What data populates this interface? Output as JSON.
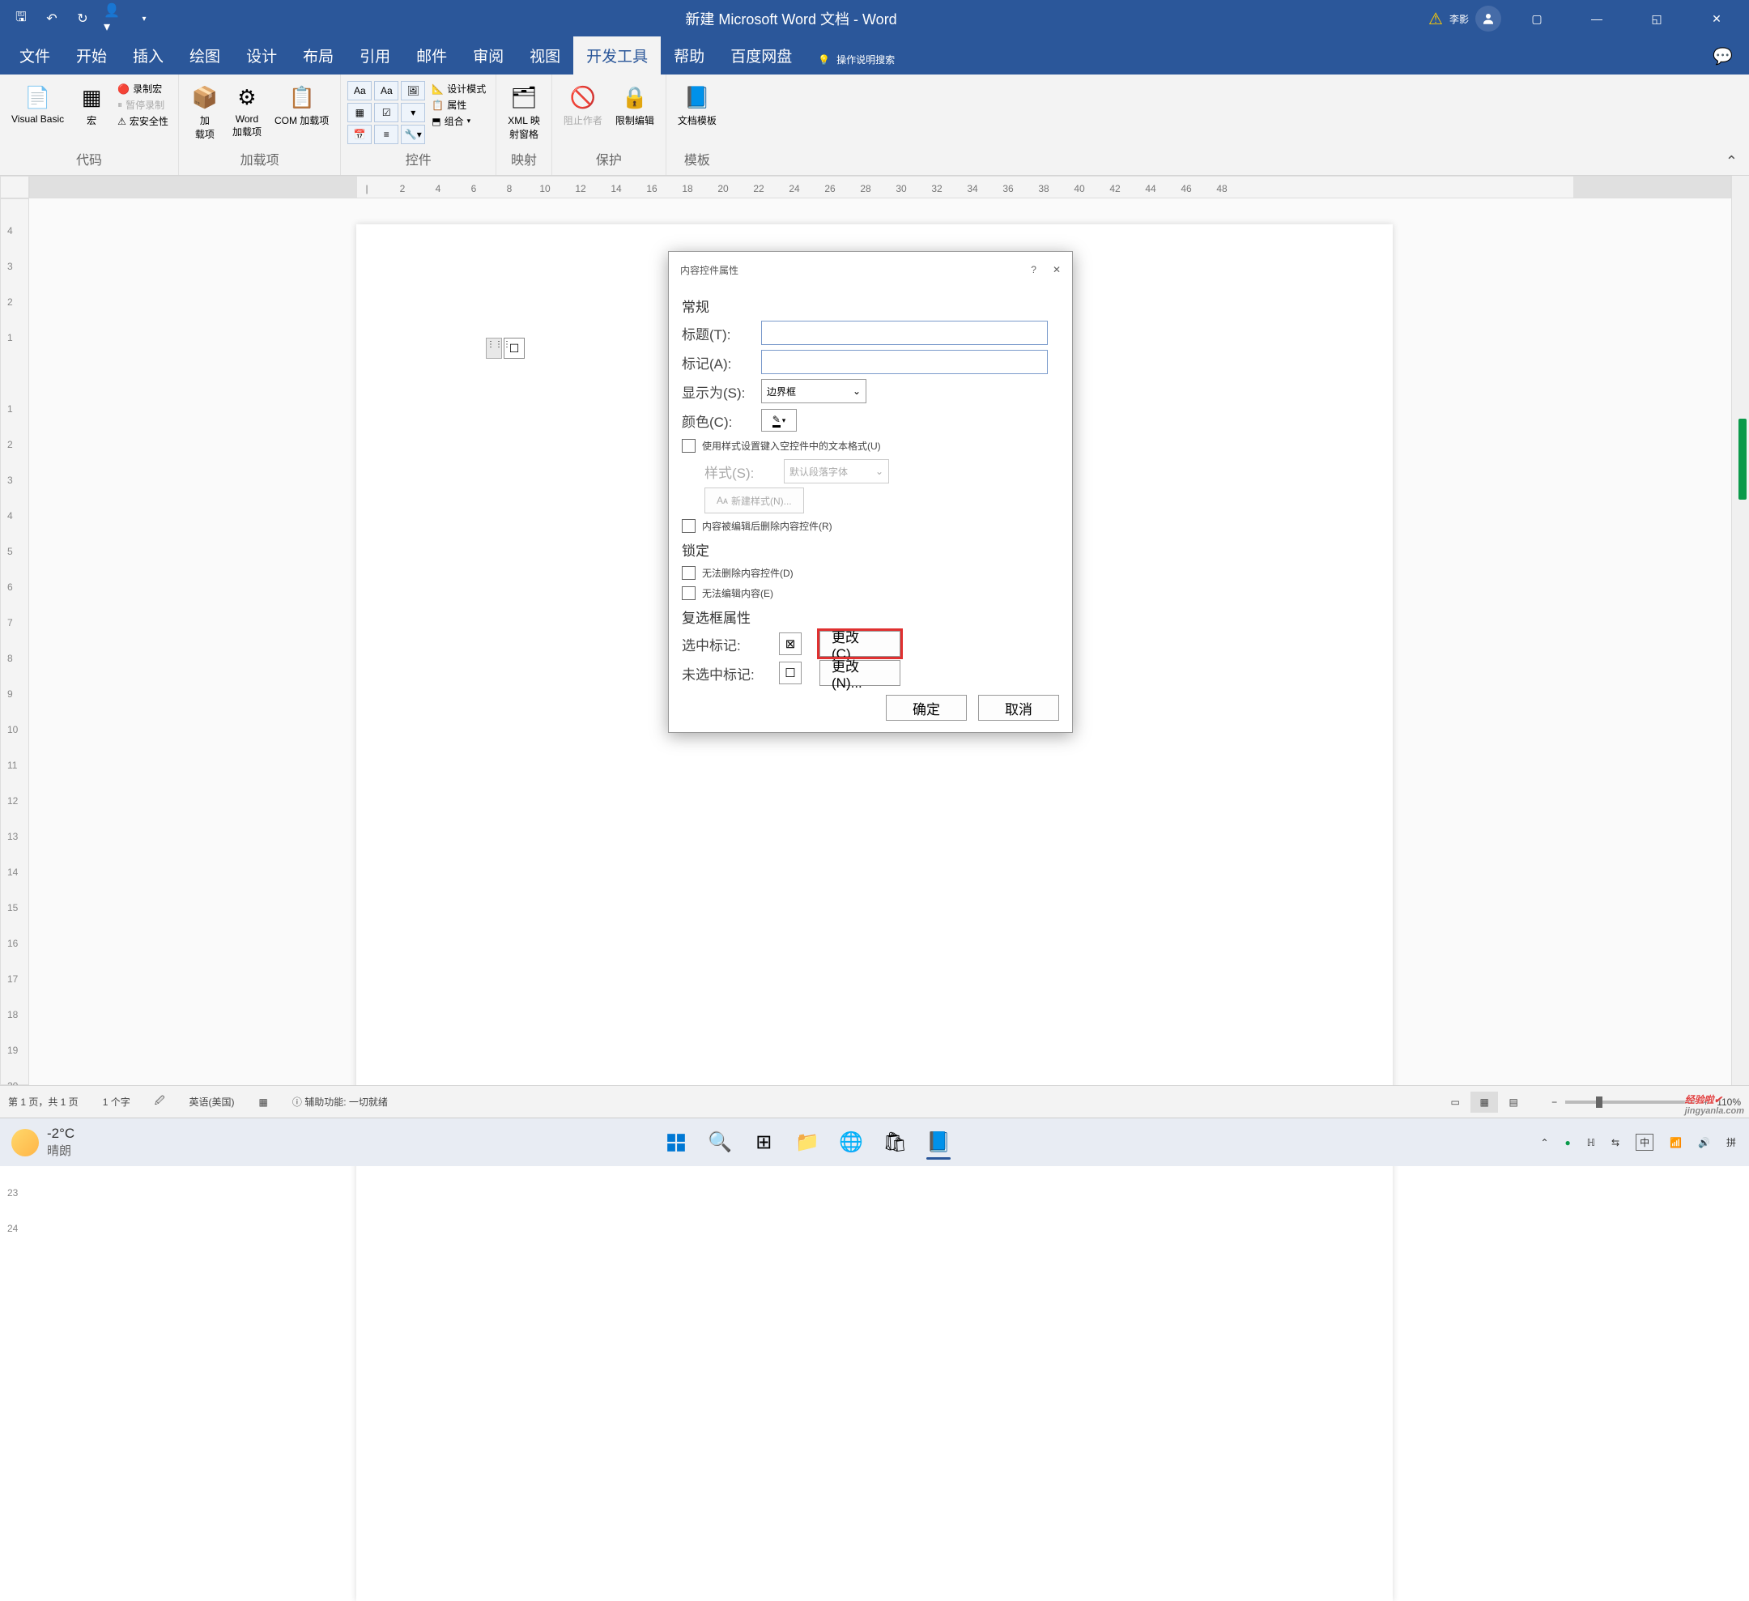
{
  "titlebar": {
    "title": "新建 Microsoft Word 文档  -  Word",
    "user": "李影"
  },
  "qa": [
    "save-icon",
    "undo-icon",
    "redo-icon",
    "user-icon",
    "down-icon"
  ],
  "tabs": [
    "文件",
    "开始",
    "插入",
    "绘图",
    "设计",
    "布局",
    "引用",
    "邮件",
    "审阅",
    "视图",
    "开发工具",
    "帮助",
    "百度网盘"
  ],
  "activeTab": "开发工具",
  "tellme": "操作说明搜索",
  "ribbon": {
    "code": {
      "vb": "Visual Basic",
      "macro": "宏",
      "record": "录制宏",
      "pause": "暂停录制",
      "security": "宏安全性",
      "label": "代码"
    },
    "addins": {
      "addin": "加\n载项",
      "word": "Word\n加载项",
      "com": "COM 加载项",
      "label": "加载项"
    },
    "controls": {
      "design": "设计模式",
      "props": "属性",
      "group": "组合",
      "label": "控件"
    },
    "mapping": {
      "xml": "XML 映\n射窗格",
      "label": "映射"
    },
    "protect": {
      "block": "阻止作者",
      "restrict": "限制编辑",
      "label": "保护"
    },
    "template": {
      "tmpl": "文档模板",
      "label": "模板"
    }
  },
  "dialog": {
    "title": "内容控件属性",
    "general": "常规",
    "labels": {
      "title": "标题(T):",
      "tag": "标记(A):",
      "showAs": "显示为(S):",
      "color": "颜色(C):",
      "style": "样式(S):"
    },
    "showAsValue": "边界框",
    "useStyle": "使用样式设置键入空控件中的文本格式(U)",
    "styleValue": "默认段落字体",
    "newStyle": "新建样式(N)...",
    "removeOnEdit": "内容被编辑后删除内容控件(R)",
    "lock": "锁定",
    "noDelete": "无法删除内容控件(D)",
    "noEdit": "无法编辑内容(E)",
    "cbprops": "复选框属性",
    "checkedLabel": "选中标记:",
    "uncheckedLabel": "未选中标记:",
    "change1": "更改(C)...",
    "change2": "更改(N)...",
    "ok": "确定",
    "cancel": "取消"
  },
  "status": {
    "page": "第 1 页，共 1 页",
    "words": "1 个字",
    "lang": "英语(美国)",
    "a11y": "辅助功能: 一切就绪",
    "zoom": "110%"
  },
  "taskbar": {
    "temp": "-2°C",
    "weather": "晴朗",
    "ime1": "中",
    "ime2": "拼",
    "time": "",
    "net": "",
    "watermark": "经验啦✔",
    "watermark2": "jingyanla.com"
  }
}
